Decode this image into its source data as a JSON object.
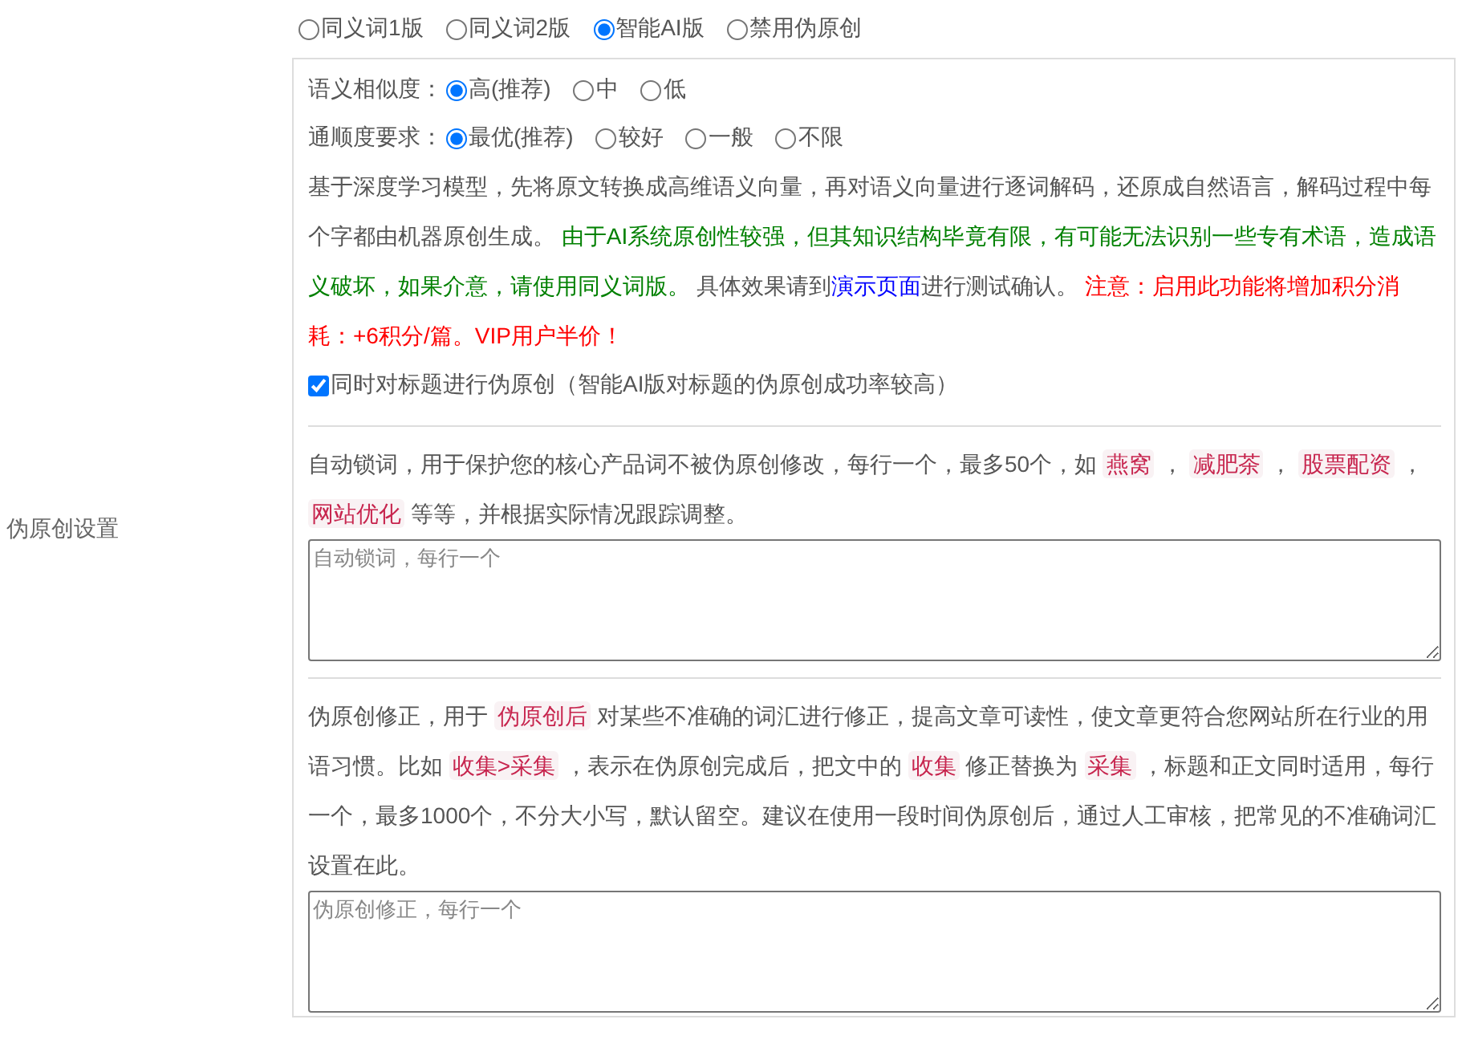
{
  "section_label": "伪原创设置",
  "modes": [
    {
      "label": "同义词1版",
      "selected": false
    },
    {
      "label": "同义词2版",
      "selected": false
    },
    {
      "label": "智能AI版",
      "selected": true
    },
    {
      "label": "禁用伪原创",
      "selected": false
    }
  ],
  "similarity": {
    "label": "语义相似度：",
    "options": [
      {
        "label": "高(推荐)",
        "selected": true
      },
      {
        "label": "中",
        "selected": false
      },
      {
        "label": "低",
        "selected": false
      }
    ]
  },
  "fluency": {
    "label": "通顺度要求：",
    "options": [
      {
        "label": "最优(推荐)",
        "selected": true
      },
      {
        "label": "较好",
        "selected": false
      },
      {
        "label": "一般",
        "selected": false
      },
      {
        "label": "不限",
        "selected": false
      }
    ]
  },
  "description": [
    {
      "kind": "plain",
      "text": "基于深度学习模型，先将原文转换成高维语义向量，再对语义向量进行逐词解码，还原成自然语言，解码过程中每个字都由机器原创生成。 "
    },
    {
      "kind": "green",
      "text": "由于AI系统原创性较强，但其知识结构毕竟有限，有可能无法识别一些专有术语，造成语义破坏，如果介意，请使用同义词版。"
    },
    {
      "kind": "plain",
      "text": " 具体效果请到"
    },
    {
      "kind": "link",
      "text": "演示页面"
    },
    {
      "kind": "plain",
      "text": "进行测试确认。 "
    },
    {
      "kind": "red",
      "text": "注意：启用此功能将增加积分消耗：+6积分/篇。VIP用户半价！"
    }
  ],
  "title_option": {
    "label": "同时对标题进行伪原创（智能AI版对标题的伪原创成功率较高）",
    "checked": true
  },
  "lock_words": {
    "description": [
      {
        "kind": "plain",
        "text": "自动锁词，用于保护您的核心产品词不被伪原创修改，每行一个，最多50个，如 "
      },
      {
        "kind": "code",
        "text": "燕窝"
      },
      {
        "kind": "plain",
        "text": " ， "
      },
      {
        "kind": "code",
        "text": "减肥茶"
      },
      {
        "kind": "plain",
        "text": " ， "
      },
      {
        "kind": "code",
        "text": "股票配资"
      },
      {
        "kind": "plain",
        "text": " ， "
      },
      {
        "kind": "code",
        "text": "网站优化"
      },
      {
        "kind": "plain",
        "text": " 等等，并根据实际情况跟踪调整。"
      }
    ],
    "placeholder": "自动锁词，每行一个"
  },
  "corrections": {
    "description": [
      {
        "kind": "plain",
        "text": "伪原创修正，用于 "
      },
      {
        "kind": "code",
        "text": "伪原创后"
      },
      {
        "kind": "plain",
        "text": " 对某些不准确的词汇进行修正，提高文章可读性，使文章更符合您网站所在行业的用语习惯。比如 "
      },
      {
        "kind": "code",
        "text": "收集>采集"
      },
      {
        "kind": "plain",
        "text": " ，表示在伪原创完成后，把文中的 "
      },
      {
        "kind": "code",
        "text": "收集"
      },
      {
        "kind": "plain",
        "text": " 修正替换为 "
      },
      {
        "kind": "code",
        "text": "采集"
      },
      {
        "kind": "plain",
        "text": " ，标题和正文同时适用，每行一个，最多1000个，不分大小写，默认留空。建议在使用一段时间伪原创后，通过人工审核，把常见的不准确词汇设置在此。"
      }
    ],
    "placeholder": "伪原创修正，每行一个"
  }
}
